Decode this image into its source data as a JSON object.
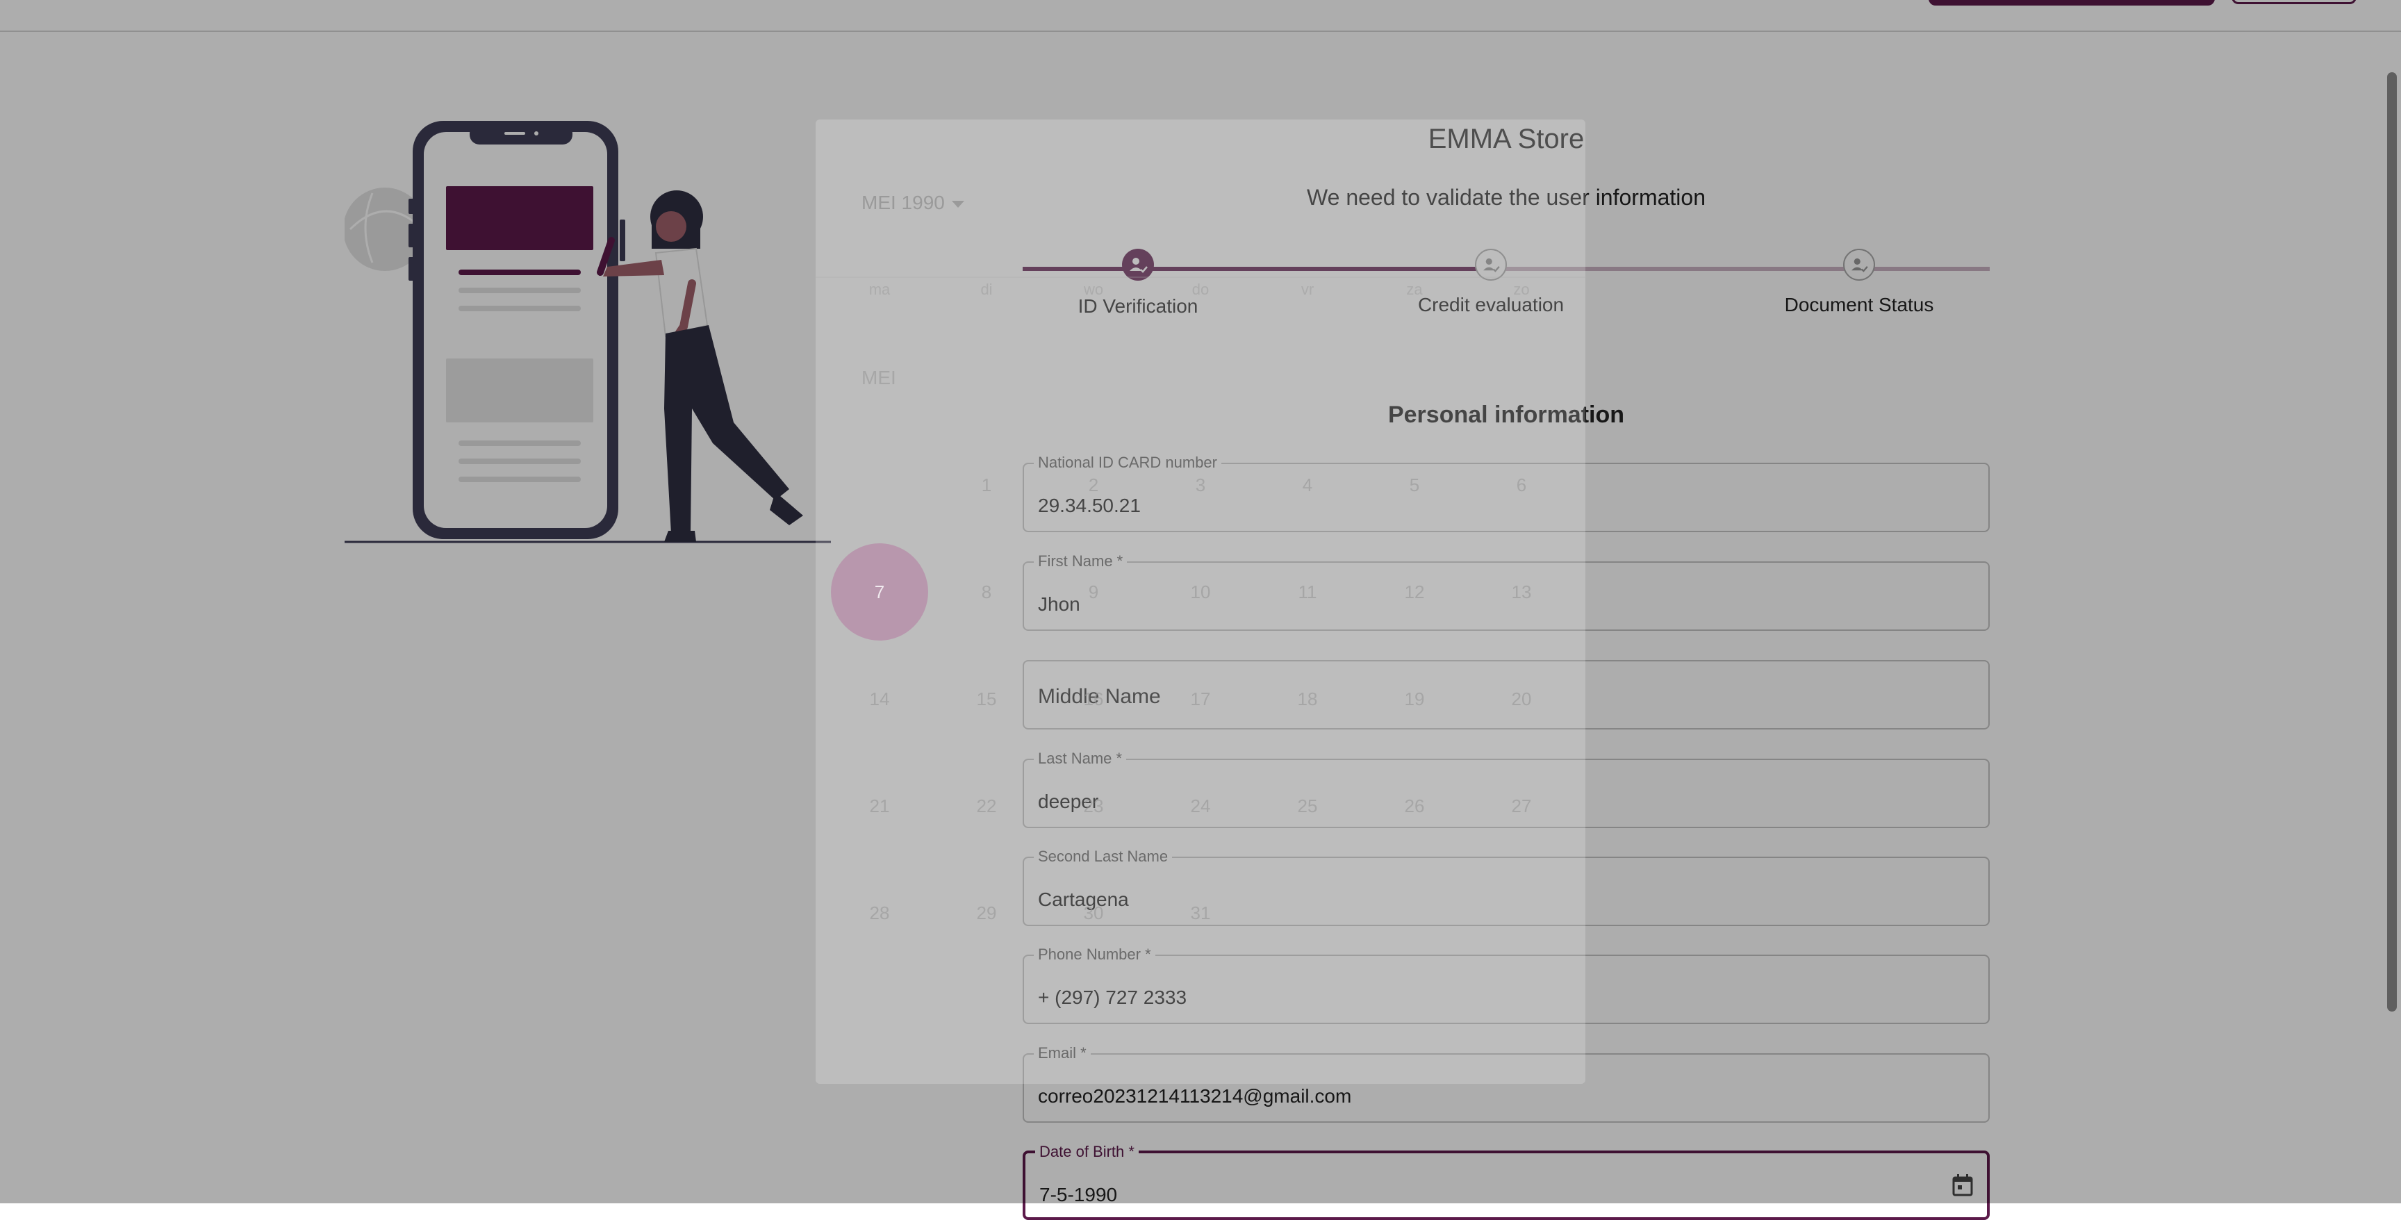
{
  "app": {
    "title": "EMMA Store",
    "subtitle": "We need to validate the user information"
  },
  "colors": {
    "brand": "#5c1a4a",
    "stepper_track": "#c9b2c2"
  },
  "stepper": {
    "steps": [
      {
        "label": "ID Verification",
        "status": "active",
        "icon": "user-check-icon"
      },
      {
        "label": "Credit evaluation",
        "status": "pending",
        "icon": "user-check-icon"
      },
      {
        "label": "Document Status",
        "status": "pending",
        "icon": "user-check-icon"
      }
    ]
  },
  "form": {
    "section_title": "Personal information",
    "id_number": {
      "label": "National ID CARD number",
      "value": "29.34.50.21"
    },
    "first_name": {
      "label": "First Name *",
      "value": "Jhon"
    },
    "middle_name": {
      "placeholder": "Middle Name"
    },
    "last_name": {
      "label": "Last Name *",
      "value": "deeper"
    },
    "second_last_name": {
      "label": "Second Last Name",
      "value": "Cartagena"
    },
    "phone": {
      "label": "Phone Number *",
      "value": "+ (297) 727 2333"
    },
    "email": {
      "label": "Email *",
      "value": "correo20231214113214@gmail.com"
    },
    "dob": {
      "label": "Date of Birth *",
      "value": "7-5-1990",
      "icon": "calendar-icon"
    }
  },
  "datepicker": {
    "header": "MEI 1990",
    "month_label": "MEI",
    "weekdays": [
      "ma",
      "di",
      "wo",
      "do",
      "vr",
      "za",
      "zo"
    ],
    "days": [
      "1",
      "2",
      "3",
      "4",
      "5",
      "6",
      "7",
      "8",
      "9",
      "10",
      "11",
      "12",
      "13",
      "14",
      "15",
      "16",
      "17",
      "18",
      "19",
      "20",
      "21",
      "22",
      "23",
      "24",
      "25",
      "26",
      "27",
      "28",
      "29",
      "30",
      "31"
    ],
    "selected_day": "7"
  }
}
